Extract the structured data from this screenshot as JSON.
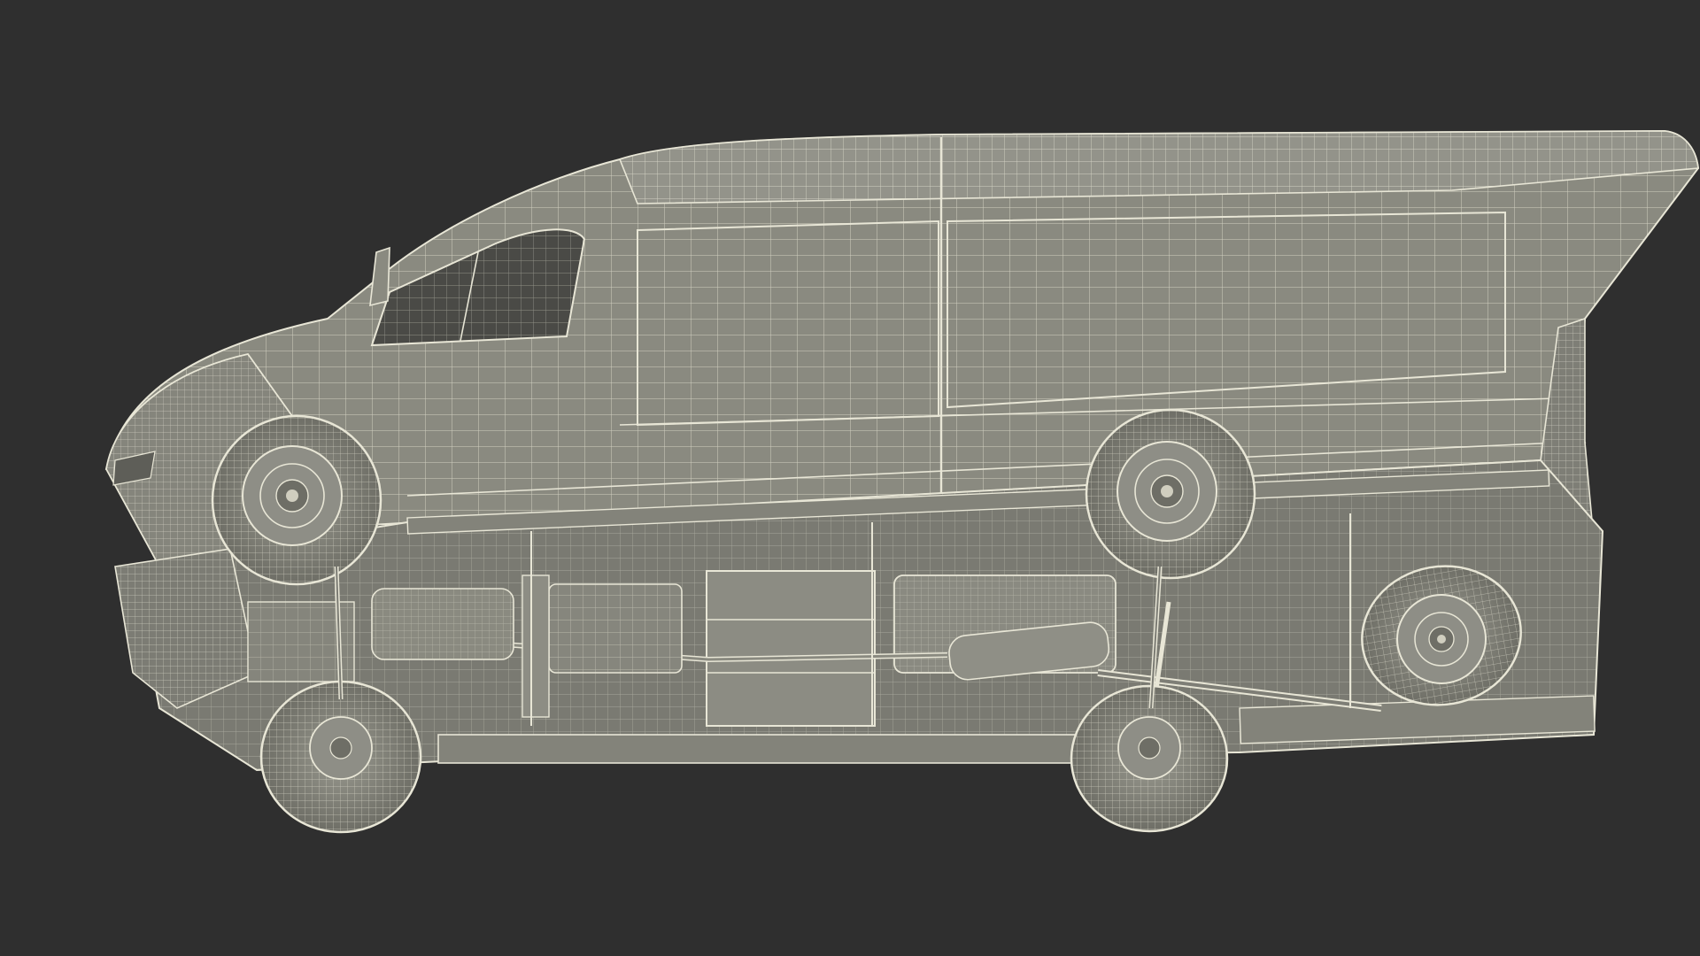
{
  "scene": {
    "background_color": "#2f2f2f",
    "model_color": "#8a8a80",
    "wire_color": "#e8e6d6",
    "shadow_color": "#5e5e58",
    "subject": "van-wireframe-underside-render"
  }
}
